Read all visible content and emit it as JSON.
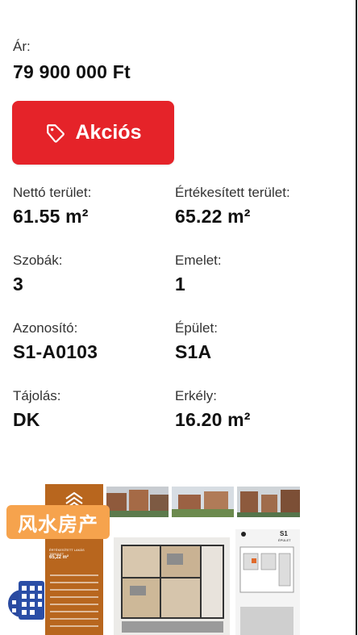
{
  "price": {
    "label": "Ár:",
    "value": "79 900 000 Ft"
  },
  "deal_button": {
    "label": "Akciós",
    "icon": "tag-icon",
    "color": "#e52329"
  },
  "details": {
    "net_area": {
      "label": "Nettó terület:",
      "value": "61.55 m²"
    },
    "sale_area": {
      "label": "Értékesített terület:",
      "value": "65.22 m²"
    },
    "rooms": {
      "label": "Szobák:",
      "value": "3"
    },
    "floor": {
      "label": "Emelet:",
      "value": "1"
    },
    "id": {
      "label": "Azonosító:",
      "value": "S1-A0103"
    },
    "building": {
      "label": "Épület:",
      "value": "S1A"
    },
    "orientation": {
      "label": "Tájolás:",
      "value": "DK"
    },
    "balcony": {
      "label": "Erkély:",
      "value": "16.20 m²"
    }
  },
  "gallery": {
    "brochure_title": "ÉRTÉKESÍTETT LAKÁS TERÜLET",
    "brochure_area": "65,22 m²",
    "siteplan_label": "S1",
    "siteplan_sub": "ÉPÜLET"
  },
  "watermark": {
    "text": "风水房产"
  }
}
